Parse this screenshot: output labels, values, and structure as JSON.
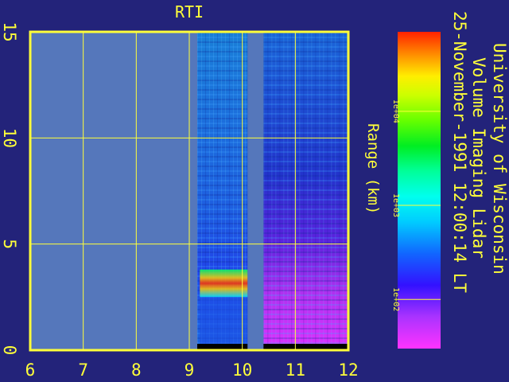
{
  "chart_data": {
    "type": "heatmap",
    "title": "RTI",
    "xlabel": "",
    "ylabel": "Range (km)",
    "xlim": [
      6,
      12
    ],
    "ylim": [
      0,
      15
    ],
    "x_ticks": [
      "6",
      "7",
      "8",
      "9",
      "10",
      "11",
      "12"
    ],
    "y_ticks": [
      "0",
      "5",
      "10",
      "15"
    ],
    "grid": true,
    "colorbar": {
      "scale": "log",
      "ticks": [
        "1e+04",
        "1e+03",
        "1e+02"
      ],
      "tick_values": [
        10000,
        1000,
        100
      ],
      "range": [
        30,
        70000
      ]
    },
    "data_regions": [
      {
        "x": [
          6.0,
          9.15
        ],
        "state": "no data"
      },
      {
        "x": [
          9.15,
          10.1
        ],
        "state": "measured",
        "near_surface_peak": {
          "x": [
            9.2,
            10.1
          ],
          "y": [
            2.5,
            3.8
          ]
        }
      },
      {
        "x": [
          10.1,
          10.4
        ],
        "state": "no data"
      },
      {
        "x": [
          10.4,
          12.0
        ],
        "state": "measured",
        "level_above_3km": "low",
        "level_below_3km": "very low"
      }
    ]
  },
  "header": {
    "institution": "University of Wisconsin",
    "instrument": "Volume Imaging Lidar",
    "timestamp": "25-November-1991 12:00:14 LT"
  },
  "colors": {
    "background": "#23237a",
    "frame": "#ffff3a",
    "no_data": "#5577bb"
  }
}
